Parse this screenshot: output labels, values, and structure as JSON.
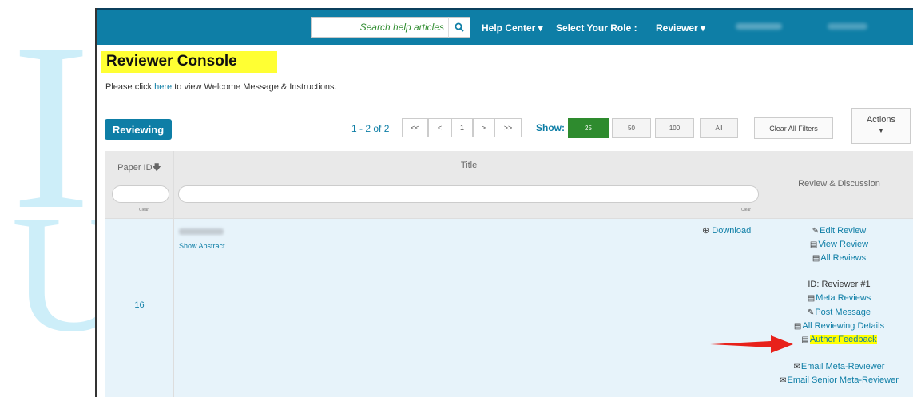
{
  "topbar": {
    "search_placeholder": "Search help articles",
    "help_center": "Help Center ▾",
    "select_role_label": "Select Your Role :",
    "role": "Reviewer ▾"
  },
  "page": {
    "title": "Reviewer Console",
    "welcome_prefix": "Please click ",
    "welcome_link": "here",
    "welcome_suffix": " to view Welcome Message & Instructions."
  },
  "toolbar": {
    "tab": "Reviewing",
    "range": "1 - 2 of 2",
    "pager": [
      "<<",
      "<",
      "1",
      ">",
      ">>"
    ],
    "show_label": "Show:",
    "page_sizes": [
      "25",
      "50",
      "100",
      "All"
    ],
    "active_page_size": "25",
    "clear_filters": "Clear All Filters",
    "actions": "Actions"
  },
  "table": {
    "headers": {
      "paper_id": "Paper ID",
      "title": "Title",
      "review_discussion": "Review & Discussion"
    },
    "clear_label": "Clear",
    "row": {
      "paper_id": "16",
      "show_abstract": "Show Abstract",
      "download": "Download",
      "links": {
        "edit_review": "Edit Review",
        "view_review": "View Review",
        "all_reviews": "All Reviews",
        "reviewer_id": "ID: Reviewer #1",
        "meta_reviews": "Meta Reviews",
        "post_message": "Post Message",
        "all_reviewing_details": "All Reviewing Details",
        "author_feedback": "Author Feedback",
        "email_meta_reviewer": "Email Meta-Reviewer",
        "email_senior_meta_reviewer": "Email Senior Meta-Reviewer"
      }
    }
  },
  "colors": {
    "topbar": "#0e7ea6",
    "title_highlight": "#ffff33",
    "active_size": "#2e8b2e",
    "arrow": "#e8211a"
  }
}
